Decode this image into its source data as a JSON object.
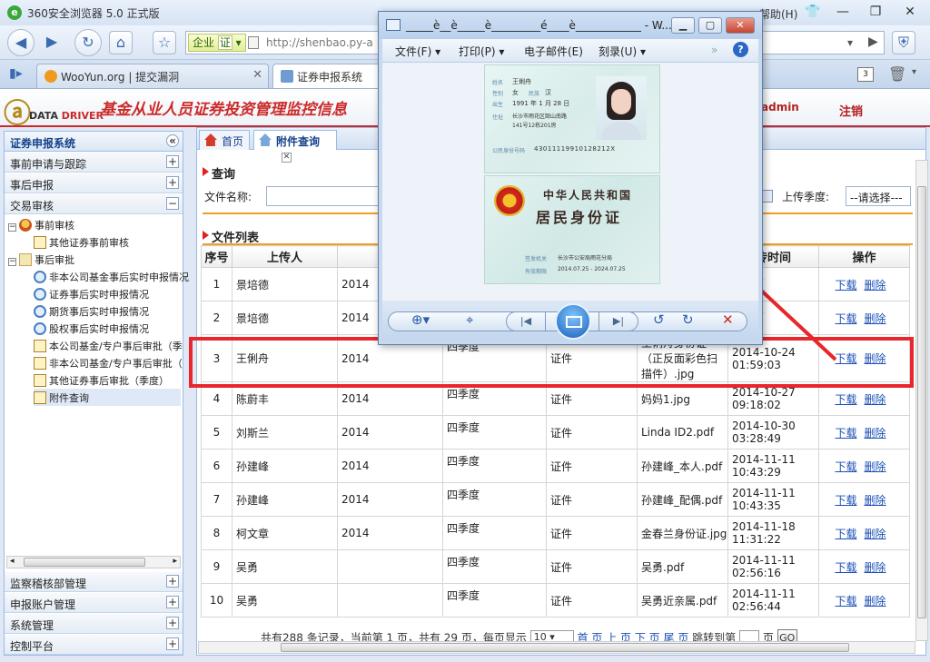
{
  "browser": {
    "title": "360安全浏览器 5.0 正式版",
    "help_menu": "帮助(H)",
    "address_badge": "企业",
    "address_badge_icon": "证",
    "url": "http://shenbao.py-a",
    "tabs": [
      {
        "label": "WooYun.org | 提交漏洞"
      },
      {
        "label": "证券申报系统"
      }
    ],
    "extra_tab_count": "3"
  },
  "site": {
    "logo_text_a": "DATA ",
    "logo_text_b": "DRIVER",
    "title": "基金从业人员证券投资管理监控信息",
    "user": "admin",
    "logout": "注销"
  },
  "left": {
    "header": "证券申报系统",
    "sections_top": [
      {
        "label": "事前申请与跟踪"
      },
      {
        "label": "事后申报"
      },
      {
        "label": "交易审核"
      }
    ],
    "tree": [
      {
        "label": "事前审核"
      },
      {
        "label": "其他证券事前审核"
      },
      {
        "label": "事后审批"
      },
      {
        "label": "非本公司基金事后实时申报情况"
      },
      {
        "label": "证券事后实时申报情况"
      },
      {
        "label": "期货事后实时申报情况"
      },
      {
        "label": "股权事后实时申报情况"
      },
      {
        "label": "本公司基金/专户事后审批（季"
      },
      {
        "label": "非本公司基金/专户事后审批（"
      },
      {
        "label": "其他证券事后审批（季度）"
      },
      {
        "label": "附件查询"
      }
    ],
    "sections_bottom": [
      {
        "label": "监察稽核部管理"
      },
      {
        "label": "申报账户管理"
      },
      {
        "label": "系统管理"
      },
      {
        "label": "控制平台"
      }
    ]
  },
  "main": {
    "tabs": [
      {
        "label": "首页"
      },
      {
        "label": "附件查询"
      }
    ],
    "query_title": "查询",
    "file_name_label": "文件名称:",
    "upload_quarter_label": "上传季度:",
    "upload_quarter_value": "--请选择---",
    "list_title": "文件列表",
    "columns": [
      "序号",
      "上传人",
      "",
      "",
      "",
      "",
      "传时间",
      "操作"
    ],
    "rows": [
      {
        "no": "1",
        "uploader": "景培德",
        "year": "2014",
        "quarter": "",
        "type": "",
        "file": "",
        "time": "10-24",
        "time2": "46"
      },
      {
        "no": "2",
        "uploader": "景培德",
        "year": "2014",
        "quarter": "",
        "type": "",
        "file": "",
        "time": "10-24",
        "time2": "12"
      },
      {
        "no": "3",
        "uploader": "王俐舟",
        "year": "2014",
        "quarter": "四季度",
        "type": "证件",
        "file": "王俐舟身份证（正反面彩色扫描件）.jpg",
        "time": "2014-10-24",
        "time2": "01:59:03"
      },
      {
        "no": "4",
        "uploader": "陈蔚丰",
        "year": "2014",
        "quarter": "四季度",
        "type": "证件",
        "file": "妈妈1.jpg",
        "time": "2014-10-27",
        "time2": "09:18:02"
      },
      {
        "no": "5",
        "uploader": "刘斯兰",
        "year": "2014",
        "quarter": "四季度",
        "type": "证件",
        "file": "Linda ID2.pdf",
        "time": "2014-10-30",
        "time2": "03:28:49"
      },
      {
        "no": "6",
        "uploader": "孙建峰",
        "year": "2014",
        "quarter": "四季度",
        "type": "证件",
        "file": "孙建峰_本人.pdf",
        "time": "2014-11-11",
        "time2": "10:43:29"
      },
      {
        "no": "7",
        "uploader": "孙建峰",
        "year": "2014",
        "quarter": "四季度",
        "type": "证件",
        "file": "孙建峰_配偶.pdf",
        "time": "2014-11-11",
        "time2": "10:43:35"
      },
      {
        "no": "8",
        "uploader": "柯文章",
        "year": "2014",
        "quarter": "四季度",
        "type": "证件",
        "file": "金春兰身份证.jpg",
        "time": "2014-11-18",
        "time2": "11:31:22"
      },
      {
        "no": "9",
        "uploader": "吴勇",
        "year": "",
        "quarter": "四季度",
        "type": "证件",
        "file": "吴勇.pdf",
        "time": "2014-11-11",
        "time2": "02:56:16"
      },
      {
        "no": "10",
        "uploader": "吴勇",
        "year": "",
        "quarter": "四季度",
        "type": "证件",
        "file": "吴勇近亲属.pdf",
        "time": "2014-11-11",
        "time2": "02:56:44"
      }
    ],
    "action_download": "下载",
    "action_delete": "删除",
    "pager": {
      "text_a": "共有288 条记录，当前第 1 页，共有 29 页，每页显示",
      "per_page": "10",
      "links": [
        "首 页",
        "上 页",
        "下 页",
        "尾 页"
      ],
      "jump_label": "跳转到第",
      "page_unit": "页",
      "go": "GO"
    }
  },
  "viewer": {
    "title": "_____è__è_____è_________é____è____________ - W...",
    "menu": [
      "文件(F)",
      "打印(P)",
      "电子邮件(E)",
      "刻录(U)"
    ],
    "id_front": {
      "name_label": "姓名",
      "name": "王俐舟",
      "sex_label": "性别",
      "sex": "女",
      "ethnic_label": "民族",
      "ethnic": "汉",
      "birth_label": "出生",
      "birth": "1991 年 1 月 28 日",
      "addr_label": "住址",
      "addr1": "长沙市雨花区韶山南路",
      "addr2": "141号12栋201房",
      "id_label": "公民身份号码",
      "id": "43011119910128212X"
    },
    "id_back": {
      "title1": "中华人民共和国",
      "title2": "居民身份证",
      "authority_label": "签发机关",
      "authority": "长沙市公安局雨花分局",
      "validity_label": "有效期限",
      "validity": "2014.07.25 - 2024.07.25"
    }
  },
  "colors": {
    "highlight": "#e8262b",
    "site_red": "#cc2a2a",
    "link": "#1a4fb5"
  }
}
